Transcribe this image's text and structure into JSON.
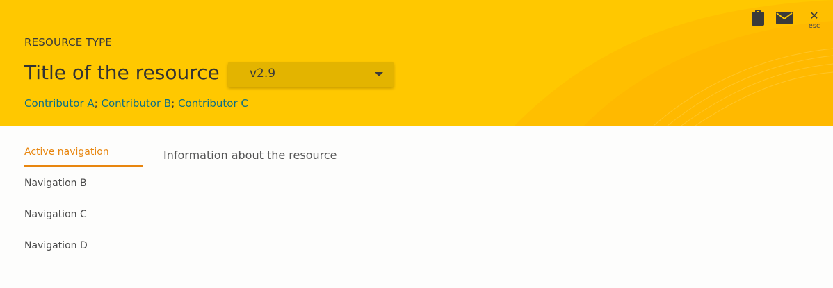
{
  "header": {
    "resource_type": "RESOURCE TYPE",
    "title": "Title of the resource",
    "version": {
      "selected": "v2.9"
    },
    "contributors": [
      "Contributor A",
      "Contributor B",
      "Contributor C"
    ],
    "contributor_separator": "; ",
    "close": {
      "label": "esc"
    },
    "background_color": "#ffc800"
  },
  "icons": {
    "clipboard": "clipboard-icon",
    "mail": "mail-icon",
    "close": "close-icon",
    "dropdown": "chevron-down-icon"
  },
  "sidebar": {
    "items": [
      {
        "label": "Active navigation",
        "active": true
      },
      {
        "label": "Navigation B",
        "active": false
      },
      {
        "label": "Navigation C",
        "active": false
      },
      {
        "label": "Navigation D",
        "active": false
      }
    ],
    "active_color": "#e8860f"
  },
  "main": {
    "info": "Information about the resource"
  }
}
